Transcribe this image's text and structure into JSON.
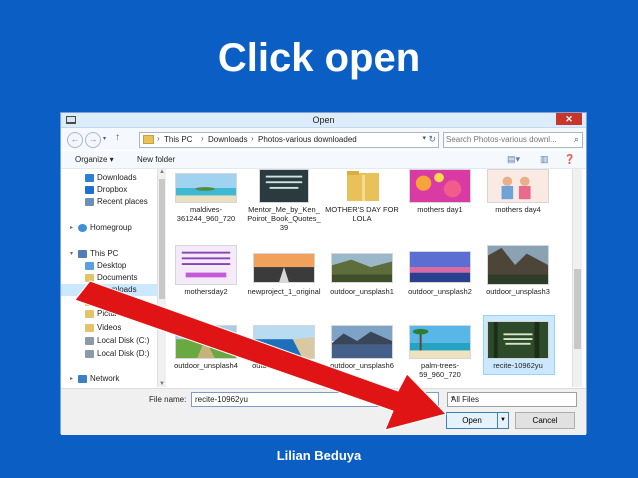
{
  "slide": {
    "title": "Click open",
    "footer": "Lilian Beduya"
  },
  "dialog": {
    "title": "Open",
    "close_glyph": "✕",
    "address": {
      "crumbs": [
        "This PC",
        "Downloads",
        "Photos-various downloaded"
      ]
    },
    "search_placeholder": "Search Photos-various downl...",
    "toolbar": {
      "organize_label": "Organize ▾",
      "new_folder_label": "New folder"
    },
    "sidebar": {
      "items": [
        {
          "label": "Downloads",
          "icon": "downloads-folder-icon",
          "color": "#2e7fd6"
        },
        {
          "label": "Dropbox",
          "icon": "dropbox-icon",
          "color": "#1d6fd1"
        },
        {
          "label": "Recent places",
          "icon": "recent-places-icon",
          "color": "#6c8fb8"
        },
        {
          "label": "Homegroup",
          "icon": "homegroup-icon",
          "color": "#3e8fd6"
        },
        {
          "label": "This PC",
          "icon": "computer-icon",
          "color": "#4d7eb5"
        },
        {
          "label": "Desktop",
          "icon": "desktop-folder-icon",
          "color": "#5aa0e0"
        },
        {
          "label": "Documents",
          "icon": "documents-folder-icon",
          "color": "#e3c46a"
        },
        {
          "label": "Downloads",
          "icon": "downloads-folder-icon",
          "color": "#2e7fd6"
        },
        {
          "label": "Music",
          "icon": "music-folder-icon",
          "color": "#e3c46a"
        },
        {
          "label": "Pictures",
          "icon": "pictures-folder-icon",
          "color": "#e3c46a"
        },
        {
          "label": "Videos",
          "icon": "videos-folder-icon",
          "color": "#e3c46a"
        },
        {
          "label": "Local Disk (C:)",
          "icon": "drive-icon",
          "color": "#8c9aa8"
        },
        {
          "label": "Local Disk (D:)",
          "icon": "drive-icon",
          "color": "#8c9aa8"
        },
        {
          "label": "Network",
          "icon": "network-icon",
          "color": "#3e7fc4"
        }
      ]
    },
    "files": [
      {
        "name": "maldives-361244_960_720",
        "thumb": "beach"
      },
      {
        "name": "Mentor_Me_by_Ken_Poirot_Book_Quotes_39",
        "thumb": "quote"
      },
      {
        "name": "MOTHER'S DAY FOR LOLA",
        "thumb": "folder"
      },
      {
        "name": "mothers day1",
        "thumb": "flowers"
      },
      {
        "name": "mothers day4",
        "thumb": "family"
      },
      {
        "name": "mothersday2",
        "thumb": "purple-text"
      },
      {
        "name": "newproject_1_original",
        "thumb": "road"
      },
      {
        "name": "outdoor_unsplash1",
        "thumb": "valley"
      },
      {
        "name": "outdoor_unsplash2",
        "thumb": "sunset"
      },
      {
        "name": "outdoor_unsplash3",
        "thumb": "cliff"
      },
      {
        "name": "outdoor_unsplash4",
        "thumb": "field"
      },
      {
        "name": "outdoor_unsplash5",
        "thumb": "sea"
      },
      {
        "name": "outdoor_unsplash6",
        "thumb": "lake"
      },
      {
        "name": "palm-trees-59_960_720",
        "thumb": "palms"
      },
      {
        "name": "recite-10962yu",
        "thumb": "forest",
        "selected": true
      }
    ],
    "file_name_label": "File name:",
    "file_name_value": "recite-10962yu",
    "file_type": "All Files",
    "open_label": "Open",
    "cancel_label": "Cancel"
  }
}
